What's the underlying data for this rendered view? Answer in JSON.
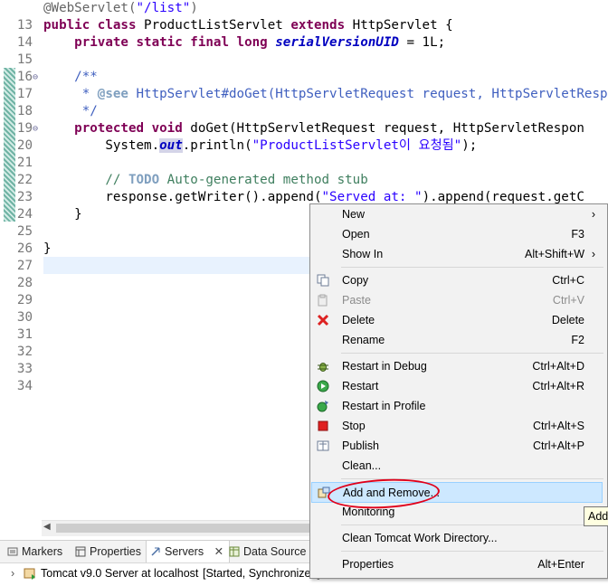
{
  "editor": {
    "lines": [
      {
        "n": "13",
        "fold": ""
      },
      {
        "n": "14",
        "fold": ""
      },
      {
        "n": "15",
        "fold": ""
      },
      {
        "n": "16",
        "fold": ""
      },
      {
        "n": "17",
        "fold": "⊖"
      },
      {
        "n": "18",
        "fold": ""
      },
      {
        "n": "19",
        "fold": ""
      },
      {
        "n": "20",
        "fold": "⊖"
      },
      {
        "n": "21",
        "fold": ""
      },
      {
        "n": "22",
        "fold": ""
      },
      {
        "n": "23",
        "fold": ""
      },
      {
        "n": "24",
        "fold": ""
      },
      {
        "n": "25",
        "fold": ""
      },
      {
        "n": "26",
        "fold": ""
      },
      {
        "n": "27",
        "fold": ""
      },
      {
        "n": "28",
        "fold": ""
      },
      {
        "n": "29",
        "fold": ""
      },
      {
        "n": "30",
        "fold": ""
      },
      {
        "n": "31",
        "fold": ""
      },
      {
        "n": "32",
        "fold": ""
      },
      {
        "n": "33",
        "fold": ""
      },
      {
        "n": "34",
        "fold": ""
      }
    ],
    "code": {
      "l13_ann": "@WebServlet(",
      "l13_str": "\"/list\"",
      "l13_end": ")",
      "l14_kw1": "public class",
      "l14_mid": " ProductListServlet ",
      "l14_kw2": "extends",
      "l14_end": " HttpServlet {",
      "l15_kw": "private static final long",
      "l15_sp": " ",
      "l15_fld": "serialVersionUID",
      "l15_end": " = 1L;",
      "l17": "/**",
      "l18_a": " * ",
      "l18_b": "@see",
      "l18_c": " HttpServlet#doGet(HttpServletRequest request, HttpServletRespo",
      "l19": " */",
      "l20_kw": "protected void",
      "l20_end": " doGet(HttpServletRequest request, HttpServletRespon",
      "l21_a": "System.",
      "l21_fld": "out",
      "l21_b": ".println(",
      "l21_str": "\"ProductListServlet이 요청됨\"",
      "l21_end": ");",
      "l23_a": "// ",
      "l23_todo": "TODO",
      "l23_b": " Auto-generated method stub",
      "l24_a": "response.getWriter().append(",
      "l24_str": "\"Served at: \"",
      "l24_b": ").append(request.getC",
      "l25": "}",
      "l27": "}"
    }
  },
  "views": {
    "tabs": [
      {
        "label": "Markers",
        "icon": "markers-icon"
      },
      {
        "label": "Properties",
        "icon": "properties-icon"
      },
      {
        "label": "Servers",
        "icon": "servers-icon",
        "close": "✕"
      },
      {
        "label": "Data Source",
        "icon": "data-source-icon"
      }
    ],
    "server_row": {
      "expand": "›",
      "name": "Tomcat v9.0 Server at localhost",
      "status": "[Started, Synchronized]"
    }
  },
  "context_menu": {
    "items": [
      {
        "label": "New",
        "shortcut": "",
        "submenu": "›",
        "icon": ""
      },
      {
        "label": "Open",
        "shortcut": "F3",
        "icon": ""
      },
      {
        "label": "Show In",
        "shortcut": "Alt+Shift+W",
        "submenu": "›",
        "icon": ""
      },
      {
        "label": "Copy",
        "shortcut": "Ctrl+C",
        "icon": "copy-icon"
      },
      {
        "label": "Paste",
        "shortcut": "Ctrl+V",
        "icon": "paste-icon",
        "disabled": true
      },
      {
        "label": "Delete",
        "shortcut": "Delete",
        "icon": "delete-icon"
      },
      {
        "label": "Rename",
        "shortcut": "F2",
        "icon": ""
      },
      {
        "label": "Restart in Debug",
        "shortcut": "Ctrl+Alt+D",
        "icon": "debug-icon"
      },
      {
        "label": "Restart",
        "shortcut": "Ctrl+Alt+R",
        "icon": "restart-icon"
      },
      {
        "label": "Restart in Profile",
        "shortcut": "",
        "icon": "profile-icon"
      },
      {
        "label": "Stop",
        "shortcut": "Ctrl+Alt+S",
        "icon": "stop-icon"
      },
      {
        "label": "Publish",
        "shortcut": "Ctrl+Alt+P",
        "icon": "publish-icon"
      },
      {
        "label": "Clean...",
        "shortcut": "",
        "icon": ""
      },
      {
        "label": "Add and Remove...",
        "shortcut": "",
        "icon": "add-remove-icon",
        "highlighted": true
      },
      {
        "label": "Monitoring",
        "shortcut": "",
        "icon": ""
      },
      {
        "label": "Clean Tomcat Work Directory...",
        "shortcut": "",
        "icon": ""
      },
      {
        "label": "Properties",
        "shortcut": "Alt+Enter",
        "icon": ""
      }
    ],
    "tooltip": "Add"
  },
  "colors": {
    "keyword": "#7f0055",
    "string": "#2a00ff",
    "javadoc": "#3f5fbf",
    "comment": "#3f7f5f",
    "highlight": "#cde8ff",
    "annotation_circle": "#e0001a"
  }
}
